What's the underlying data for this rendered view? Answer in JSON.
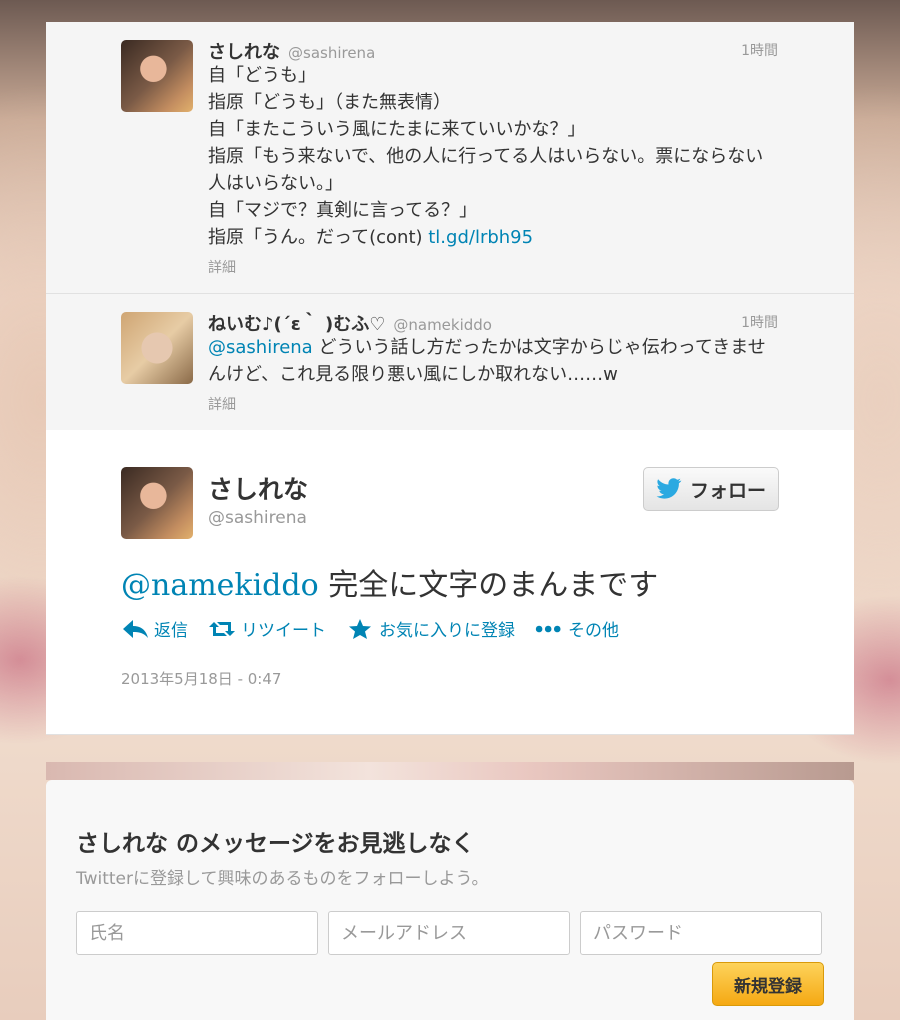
{
  "tweets": [
    {
      "fullname": "さしれな",
      "screenname": "@sashirena",
      "time": "1時間",
      "text": "自「どうも」\n指原「どうも」（また無表情）\n自「またこういう風にたまに来ていいかな？」\n指原「もう来ないで、他の人に行ってる人はいらない。票にならない人はいらない。」\n自「マジで？真剣に言ってる？」\n指原「うん。だって(cont) ",
      "link": "tl.gd/lrbh95",
      "details": "詳細"
    },
    {
      "fullname": "ねいむ♪(´ε｀ )むふ♡",
      "screenname": "@namekiddo",
      "time": "1時間",
      "mention": "@sashirena",
      "text": " どういう話し方だったかは文字からじゃ伝わってきませんけど、これ見る限り悪い風にしか取れない……w",
      "details": "詳細"
    }
  ],
  "main": {
    "fullname": "さしれな",
    "screenname": "@sashirena",
    "follow_label": "フォロー",
    "mention": "@namekiddo",
    "text": " 完全に文字のまんまです",
    "actions": {
      "reply": "返信",
      "retweet": "リツイート",
      "favorite": "お気に入りに登録",
      "more": "その他"
    },
    "timestamp": "2013年5月18日 - 0:47"
  },
  "signup": {
    "title": "さしれな のメッセージをお見逃しなく",
    "subtitle": "Twitterに登録して興味のあるものをフォローしよう。",
    "name_placeholder": "氏名",
    "email_placeholder": "メールアドレス",
    "password_placeholder": "パスワード",
    "button_label": "新規登録"
  },
  "colors": {
    "link": "#0084b4",
    "signup_button": "#f5a913"
  }
}
